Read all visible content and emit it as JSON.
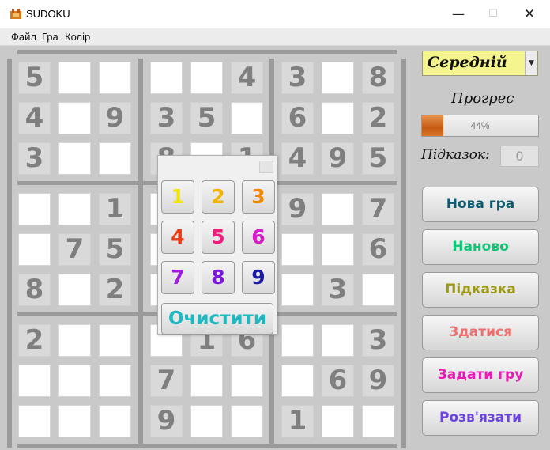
{
  "window": {
    "title": "SUDOKU",
    "minimize": "—",
    "maximize": "☐",
    "close": "✕"
  },
  "menu": [
    "Файл",
    "Гра",
    "Колір"
  ],
  "difficulty": {
    "value": "Середній",
    "arrow": "▼"
  },
  "progress": {
    "label": "Прогрес",
    "percent": 44,
    "text": "44%"
  },
  "hints": {
    "label": "Підказок:",
    "value": "0"
  },
  "buttons": [
    {
      "label": "Нова гра",
      "color": "#0e5a6e"
    },
    {
      "label": "Наново",
      "color": "#10c477"
    },
    {
      "label": "Підказка",
      "color": "#9c9a12"
    },
    {
      "label": "Здатися",
      "color": "#ef6f6f"
    },
    {
      "label": "Задати гру",
      "color": "#e81ab3"
    },
    {
      "label": "Розв'язати",
      "color": "#6b43e0"
    }
  ],
  "picker": {
    "numbers": [
      {
        "n": "1",
        "color": "#f2e600"
      },
      {
        "n": "2",
        "color": "#f3b400"
      },
      {
        "n": "3",
        "color": "#f08a00"
      },
      {
        "n": "4",
        "color": "#ef3b12"
      },
      {
        "n": "5",
        "color": "#ec1f7d"
      },
      {
        "n": "6",
        "color": "#d61cc8"
      },
      {
        "n": "7",
        "color": "#a11be0"
      },
      {
        "n": "8",
        "color": "#7a16de"
      },
      {
        "n": "9",
        "color": "#1a1aa8"
      }
    ],
    "clear_label": "Очистити"
  },
  "board": {
    "values": [
      [
        "5",
        "",
        "",
        "",
        "",
        "4",
        "3",
        "",
        "8"
      ],
      [
        "4",
        "",
        "9",
        "3",
        "5",
        "",
        "6",
        "",
        "2"
      ],
      [
        "3",
        "",
        "",
        "8",
        "",
        "1",
        "4",
        "9",
        "5"
      ],
      [
        "",
        "",
        "1",
        "",
        "",
        "",
        "9",
        "",
        "7"
      ],
      [
        "",
        "7",
        "5",
        "",
        "",
        "",
        "",
        "",
        "6"
      ],
      [
        "8",
        "",
        "2",
        "",
        "",
        "",
        "",
        "3",
        ""
      ],
      [
        "2",
        "",
        "",
        "",
        "1",
        "6",
        "",
        "",
        "3"
      ],
      [
        "",
        "",
        "",
        "7",
        "",
        "",
        "",
        "6",
        "9"
      ],
      [
        "",
        "",
        "",
        "9",
        "",
        "",
        "1",
        "",
        ""
      ]
    ],
    "given": [
      [
        1,
        0,
        0,
        0,
        0,
        1,
        1,
        0,
        1
      ],
      [
        1,
        0,
        1,
        1,
        1,
        0,
        1,
        0,
        1
      ],
      [
        1,
        0,
        0,
        1,
        0,
        1,
        1,
        1,
        1
      ],
      [
        0,
        0,
        1,
        0,
        0,
        0,
        1,
        0,
        1
      ],
      [
        0,
        1,
        1,
        0,
        0,
        0,
        0,
        0,
        1
      ],
      [
        1,
        0,
        1,
        0,
        0,
        0,
        0,
        1,
        0
      ],
      [
        1,
        0,
        0,
        0,
        1,
        1,
        0,
        0,
        1
      ],
      [
        0,
        0,
        0,
        1,
        0,
        0,
        0,
        1,
        1
      ],
      [
        0,
        0,
        0,
        1,
        0,
        0,
        1,
        0,
        0
      ]
    ]
  }
}
